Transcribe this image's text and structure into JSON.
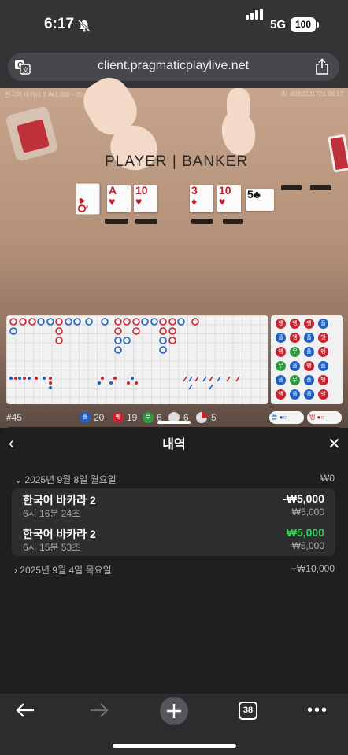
{
  "status": {
    "time": "6:17",
    "network": "5G",
    "battery": "100"
  },
  "browser": {
    "url": "client.pragmaticplaylive.net",
    "tab_count": "38"
  },
  "game": {
    "table_info": "한국어 바카라 2 ₩1,000 - 20,000,000",
    "round_id": "ID :8359291721 06:17",
    "board_text": "PLAYER | BANKER",
    "player_cards": [
      {
        "rank": "Q",
        "suit": "♥"
      },
      {
        "rank": "A",
        "suit": "♥"
      },
      {
        "rank": "10",
        "suit": "♥"
      }
    ],
    "banker_cards": [
      {
        "rank": "3",
        "suit": "♦"
      },
      {
        "rank": "10",
        "suit": "♥"
      },
      {
        "rank": "5",
        "suit": "♣"
      }
    ],
    "shoe": "#45",
    "stats": {
      "player_label": "플",
      "player_count": "20",
      "banker_label": "뱅",
      "banker_count": "19",
      "tie_label": "무",
      "tie_count": "6",
      "pair_player_count": "6",
      "pair_banker_count": "5"
    },
    "predict": {
      "player": "플",
      "banker": "뱅"
    }
  },
  "colors": {
    "player": "#1f5fc4",
    "banker": "#c8232f",
    "tie": "#2d9a40",
    "win": "#30d158"
  },
  "history": {
    "title": "내역",
    "groups": [
      {
        "date": "2025년 9월 8일 월요일",
        "total": "₩0",
        "expanded": true,
        "items": [
          {
            "game": "한국어 바카라 2",
            "time": "6시 16분 24초",
            "amount": "-₩5,000",
            "bet": "₩5,000",
            "win": false
          },
          {
            "game": "한국어 바카라 2",
            "time": "6시 15분 53초",
            "amount": "₩5,000",
            "bet": "₩5,000",
            "win": true
          }
        ]
      },
      {
        "date": "2025년 9월 4일 목요일",
        "total": "+₩10,000",
        "expanded": false,
        "items": []
      }
    ]
  }
}
